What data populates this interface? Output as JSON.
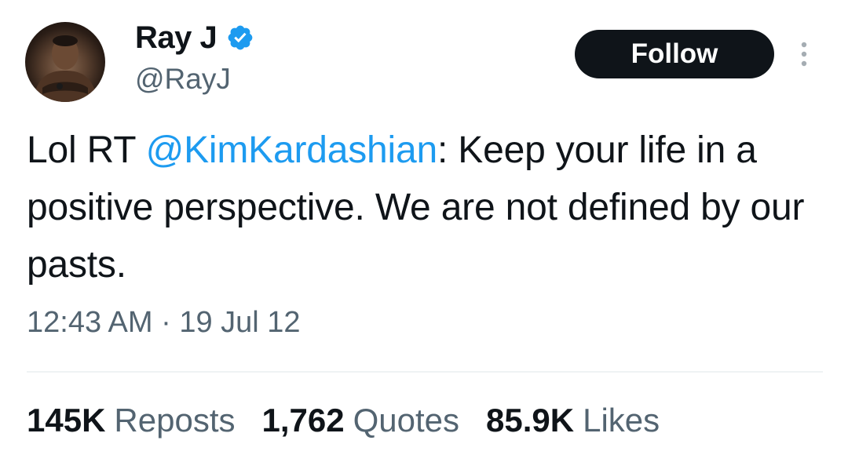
{
  "author": {
    "display_name": "Ray J",
    "handle": "@RayJ",
    "verified_icon": "verified-badge-icon",
    "avatar_icon": "profile-photo"
  },
  "actions": {
    "follow_label": "Follow",
    "more_icon": "more-vertical-icon"
  },
  "tweet": {
    "text_prefix": "Lol RT ",
    "mention": "@KimKardashian",
    "text_suffix": ": Keep your life in a positive perspective. We are not defined by our pasts.",
    "time": "12:43 AM",
    "separator": "·",
    "date": "19 Jul 12"
  },
  "stats": {
    "reposts_count": "145K",
    "reposts_label": "Reposts",
    "quotes_count": "1,762",
    "quotes_label": "Quotes",
    "likes_count": "85.9K",
    "likes_label": "Likes"
  },
  "colors": {
    "accent": "#1d9bf0",
    "text_primary": "#0f1419",
    "text_secondary": "#536471",
    "button_bg": "#0f1419"
  }
}
